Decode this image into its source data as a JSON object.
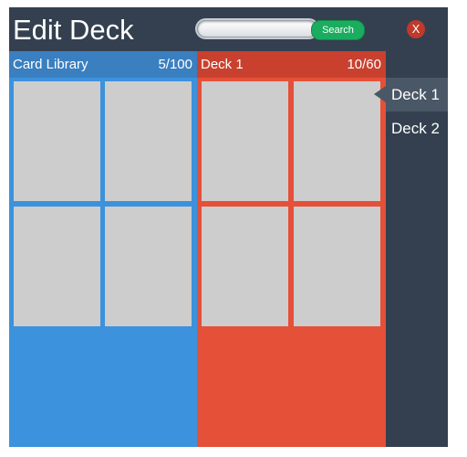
{
  "header": {
    "title": "Edit Deck",
    "search_placeholder": "",
    "search_label": "Search",
    "close_label": "X"
  },
  "library": {
    "name": "Card Library",
    "count": "5/100",
    "color": "#3c92dc",
    "card_color": "#cdcdcd"
  },
  "deck": {
    "name": "Deck 1",
    "count": "10/60",
    "color": "#e55039"
  },
  "sidebar": {
    "items": [
      {
        "label": "Deck 1",
        "active": true
      },
      {
        "label": "Deck 2",
        "active": false
      }
    ]
  },
  "colors": {
    "window_bg": "#34404f",
    "search_button": "#1aad5f",
    "close_button": "#c0392b"
  }
}
